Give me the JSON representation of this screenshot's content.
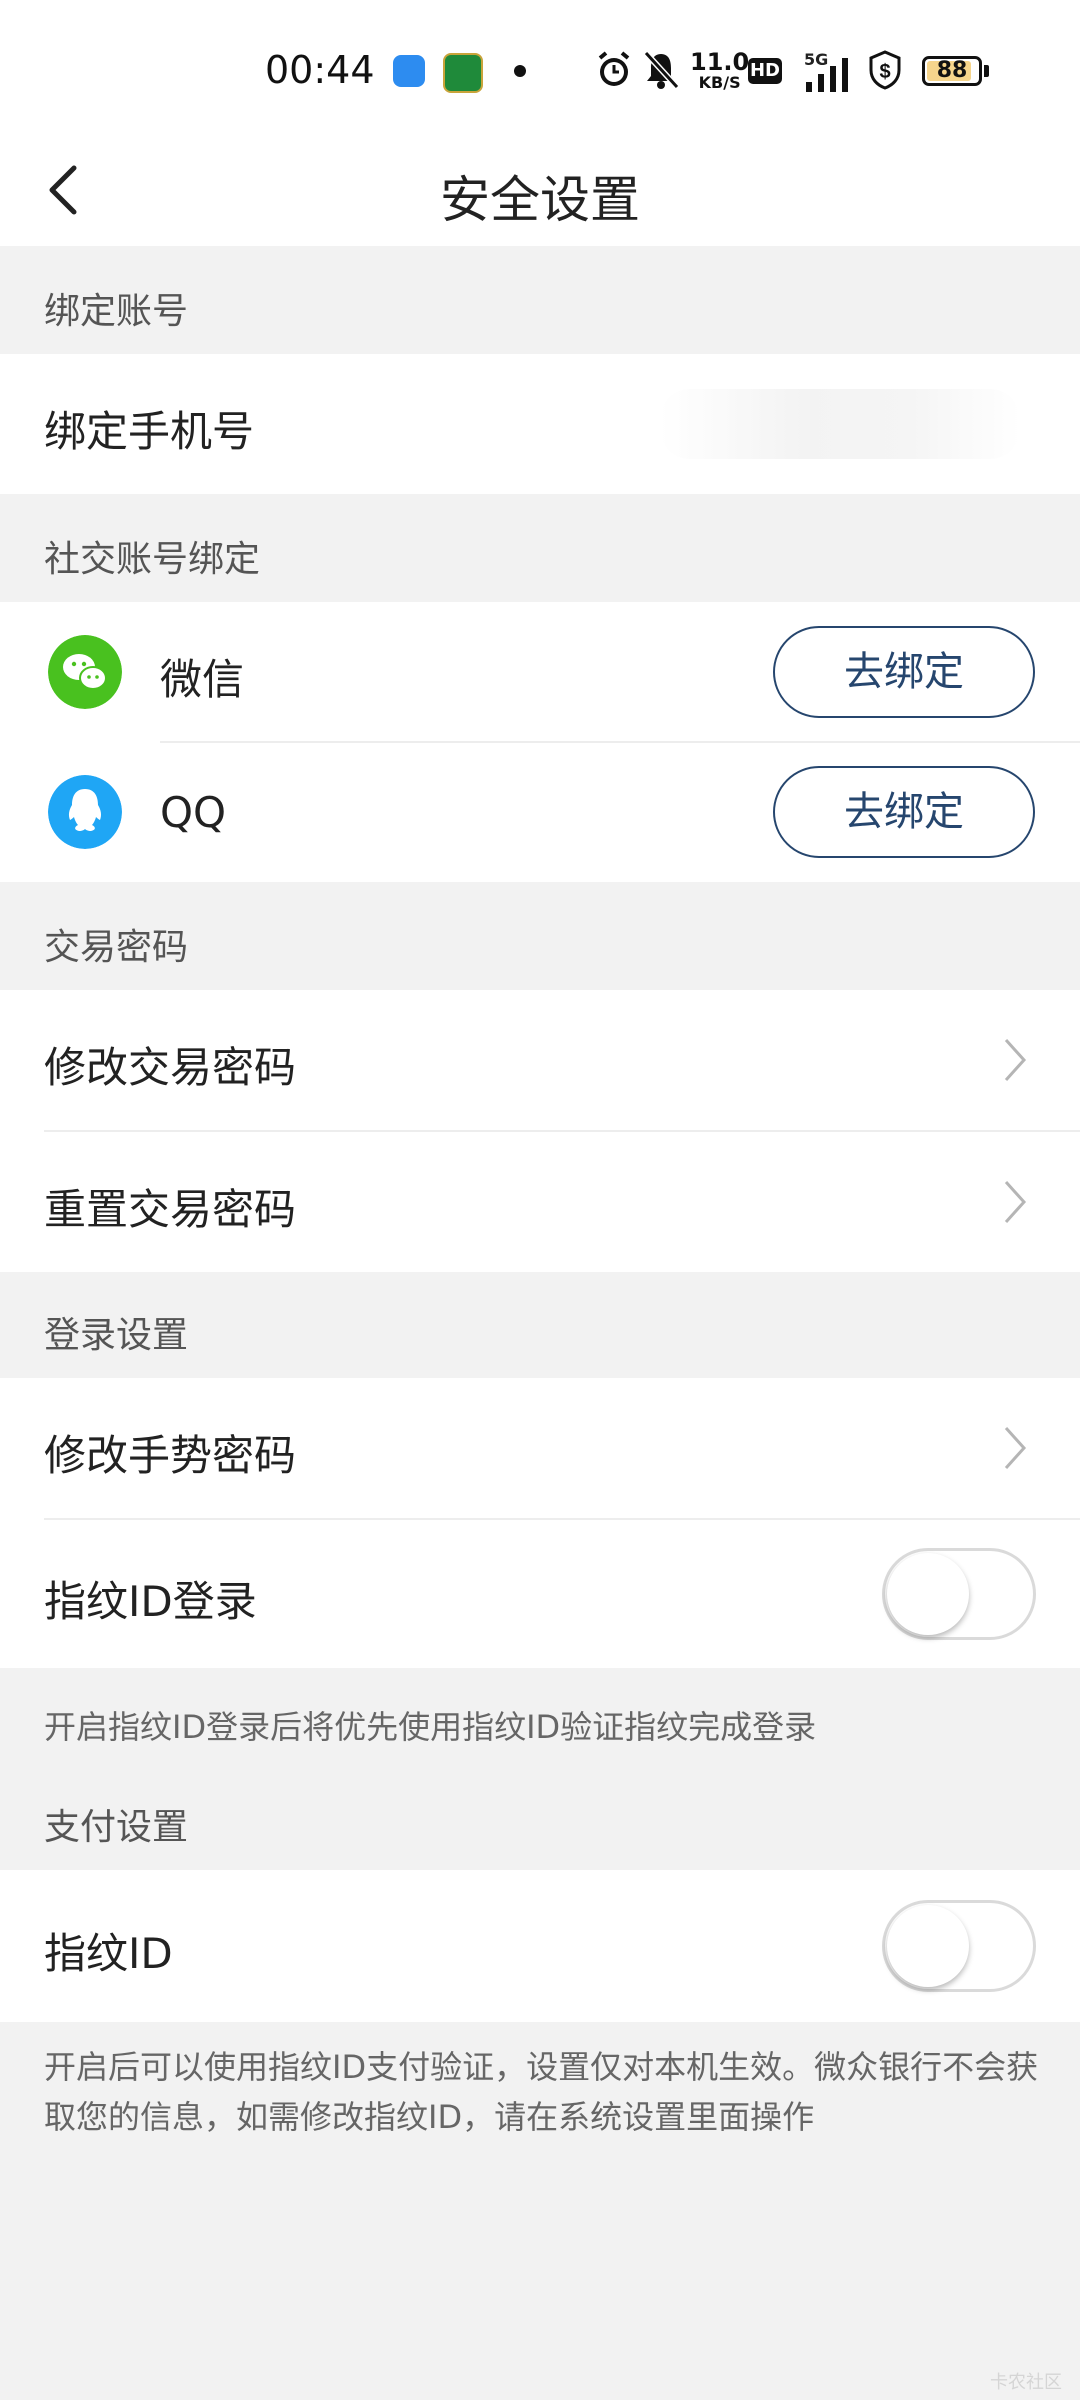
{
  "status_bar": {
    "time": "00:44",
    "speed_value": "11.0",
    "speed_unit": "KB/S",
    "hd": "HD",
    "network": "5G",
    "battery": "88",
    "battery_level": 0.88,
    "icons": [
      "alarm-icon",
      "bell-muted-icon",
      "signal-icon",
      "shield-dollar-icon",
      "battery-icon"
    ]
  },
  "nav": {
    "title": "安全设置"
  },
  "sections": {
    "account": {
      "header": "绑定账号",
      "phone_label": "绑定手机号"
    },
    "social": {
      "header": "社交账号绑定",
      "wechat_label": "微信",
      "qq_label": "QQ",
      "bind_label": "去绑定"
    },
    "trade": {
      "header": "交易密码",
      "modify_label": "修改交易密码",
      "reset_label": "重置交易密码"
    },
    "login": {
      "header": "登录设置",
      "gesture_label": "修改手势密码",
      "fingerprint_label": "指纹ID登录",
      "fingerprint_on": false,
      "note": "开启指纹ID登录后将优先使用指纹ID验证指纹完成登录"
    },
    "pay": {
      "header": "支付设置",
      "fingerprint_label": "指纹ID",
      "fingerprint_on": false,
      "note": "开启后可以使用指纹ID支付验证，设置仅对本机生效。微众银行不会获取您的信息，如需修改指纹ID，请在系统设置里面操作"
    }
  },
  "colors": {
    "accent": "#26466e",
    "wechat": "#49c11f",
    "qq": "#1fa6f5",
    "background": "#f2f2f2"
  },
  "watermark": "卡农社区"
}
